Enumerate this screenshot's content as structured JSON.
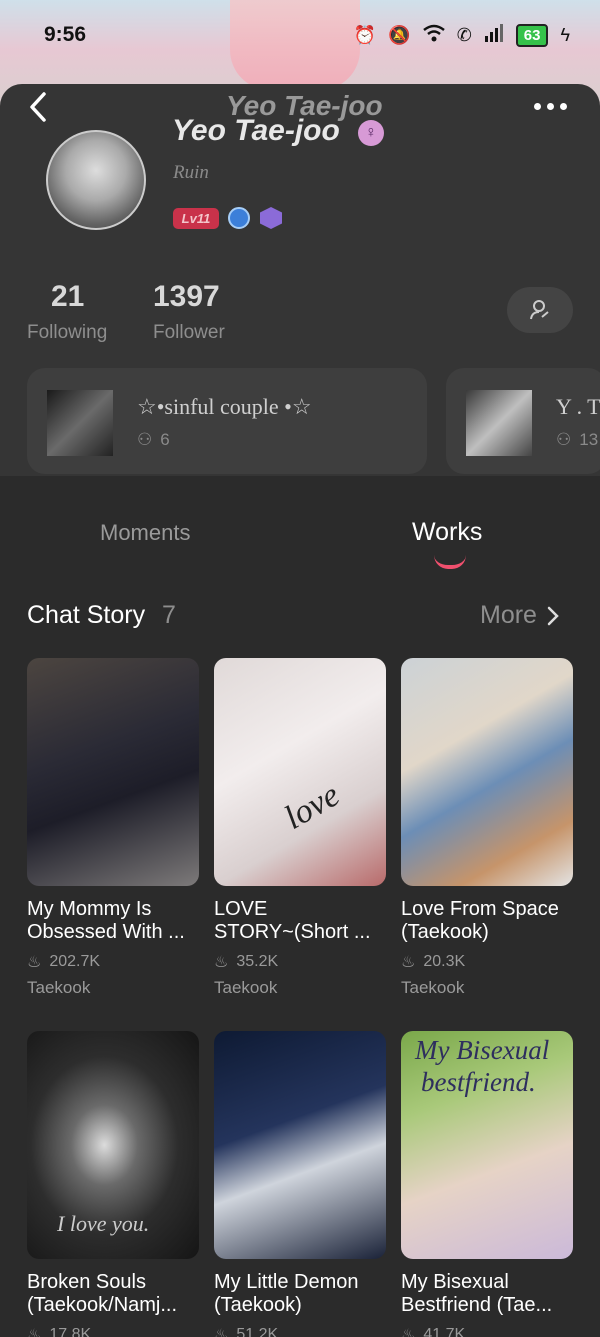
{
  "status_bar": {
    "time": "9:56",
    "battery": "63"
  },
  "profile": {
    "ghost_title": "Yeo Tae-joo",
    "name": "Yeo Tae-joo",
    "gender_icon": "female-icon",
    "bio": "Ruin",
    "level": "Lv11"
  },
  "stats": {
    "following_count": "21",
    "following_label": "Following",
    "follower_count": "1397",
    "follower_label": "Follower"
  },
  "groups": [
    {
      "title": "☆•sinful couple •☆",
      "members": "6"
    },
    {
      "title": "Y . T",
      "members": "13"
    }
  ],
  "tabs": {
    "moments": "Moments",
    "works": "Works",
    "active": "Works"
  },
  "section": {
    "title": "Chat Story",
    "count": "7",
    "more": "More"
  },
  "stories": [
    {
      "title1": "My Mommy Is",
      "title2": "Obsessed With ...",
      "views": "202.7K",
      "tag": "Taekook"
    },
    {
      "title1": "LOVE",
      "title2": "STORY~(Short ...",
      "views": "35.2K",
      "tag": "Taekook"
    },
    {
      "title1": "Love From Space",
      "title2": "(Taekook)",
      "views": "20.3K",
      "tag": "Taekook"
    },
    {
      "title1": "Broken Souls",
      "title2": "(Taekook/Namj...",
      "views": "17.8K",
      "tag": ""
    },
    {
      "title1": "My Little Demon",
      "title2": "(Taekook)",
      "views": "51.2K",
      "tag": ""
    },
    {
      "title1": "My Bisexual",
      "title2": "Bestfriend (Tae...",
      "views": "41.7K",
      "tag": ""
    }
  ],
  "covers": {
    "c2_text": "love",
    "c4_text": "I love you.",
    "c6_line1": "My Bisexual",
    "c6_line2": "bestfriend."
  },
  "colors": {
    "accent": "#f0506e",
    "level_badge": "#c9324a"
  }
}
